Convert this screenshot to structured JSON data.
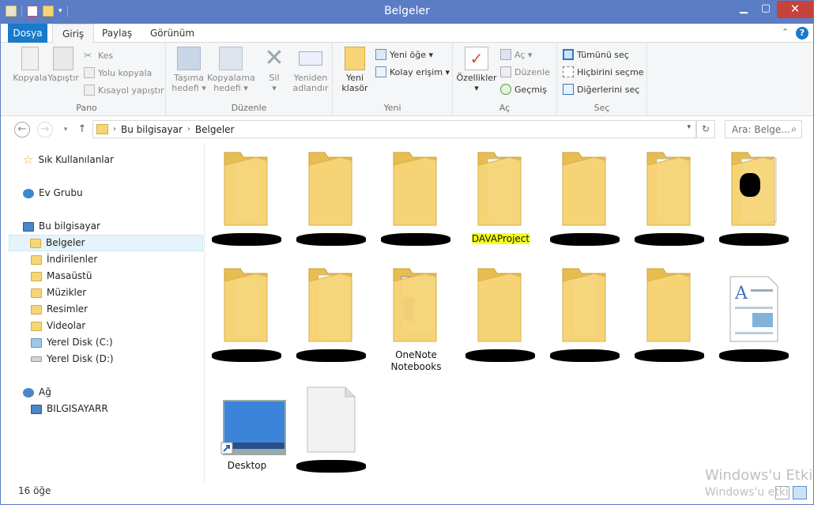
{
  "window": {
    "title": "Belgeler",
    "min": "▁",
    "max": "▢",
    "close": "✕"
  },
  "tabs": {
    "file": "Dosya",
    "home": "Giriş",
    "share": "Paylaş",
    "view": "Görünüm"
  },
  "ribbon": {
    "pano": {
      "label": "Pano",
      "copy": "Kopyala",
      "paste": "Yapıştır",
      "cut": "Kes",
      "copy_path": "Yolu kopyala",
      "paste_shortcut": "Kısayol yapıştır"
    },
    "duzenle": {
      "label": "Düzenle",
      "move_to_1": "Taşıma",
      "move_to_2": "hedefi ▾",
      "copy_to_1": "Kopyalama",
      "copy_to_2": "hedefi ▾",
      "delete": "Sil",
      "delete_arrow": "▾",
      "rename_1": "Yeniden",
      "rename_2": "adlandır"
    },
    "yeni": {
      "label": "Yeni",
      "new_folder_1": "Yeni",
      "new_folder_2": "klasör",
      "new_item": "Yeni öğe ▾",
      "easy_access": "Kolay erişim ▾"
    },
    "ac": {
      "label": "Aç",
      "properties": "Özellikler",
      "properties_arrow": "▾",
      "open": "Aç ▾",
      "edit": "Düzenle",
      "history": "Geçmiş"
    },
    "sec": {
      "label": "Seç",
      "select_all": "Tümünü seç",
      "select_none": "Hiçbirini seçme",
      "invert": "Diğerlerini seç"
    }
  },
  "address": {
    "crumbs": [
      "Bu bilgisayar",
      "Belgeler"
    ],
    "sep": "›",
    "search_placeholder": "Ara: Belge...",
    "search_icon": "magnifier-icon"
  },
  "nav": {
    "quick": "Sık Kullanılanlar",
    "homegroup": "Ev Grubu",
    "thispc": "Bu bilgisayar",
    "children": [
      "Belgeler",
      "İndirilenler",
      "Masaüstü",
      "Müzikler",
      "Resimler",
      "Videolar",
      "Yerel Disk (C:)",
      "Yerel Disk (D:)"
    ],
    "network": "Ağ",
    "network_child": "BILGISAYARR"
  },
  "items": [
    {
      "label": "",
      "type": "folder-docs"
    },
    {
      "label": "",
      "type": "folder"
    },
    {
      "label": "",
      "type": "folder"
    },
    {
      "label": "DAVAProject",
      "type": "folder-paper",
      "highlight": true
    },
    {
      "label": "",
      "type": "folder"
    },
    {
      "label": "",
      "type": "folder-paper"
    },
    {
      "label": "",
      "type": "folder-black"
    },
    {
      "label": "",
      "type": "folder-docs"
    },
    {
      "label": "",
      "type": "folder-paper"
    },
    {
      "label": "OneNote Notebooks",
      "type": "folder-onenote"
    },
    {
      "label": "",
      "type": "folder"
    },
    {
      "label": "",
      "type": "folder-docs"
    },
    {
      "label": "",
      "type": "folder"
    },
    {
      "label": "",
      "type": "doc-wordpad"
    },
    {
      "label": "Desktop",
      "type": "desktop-shortcut"
    },
    {
      "label": "",
      "type": "file-blank"
    }
  ],
  "status": {
    "count": "16 öğe"
  },
  "watermark": {
    "line1": "Windows'u Etki",
    "line2": "Windows'u etki"
  },
  "colors": {
    "titlebar": "#5b7dc6",
    "file_tab": "#1979ca",
    "close": "#c7423a",
    "folder": "#f7d577",
    "highlight": "#f6ff1a"
  }
}
